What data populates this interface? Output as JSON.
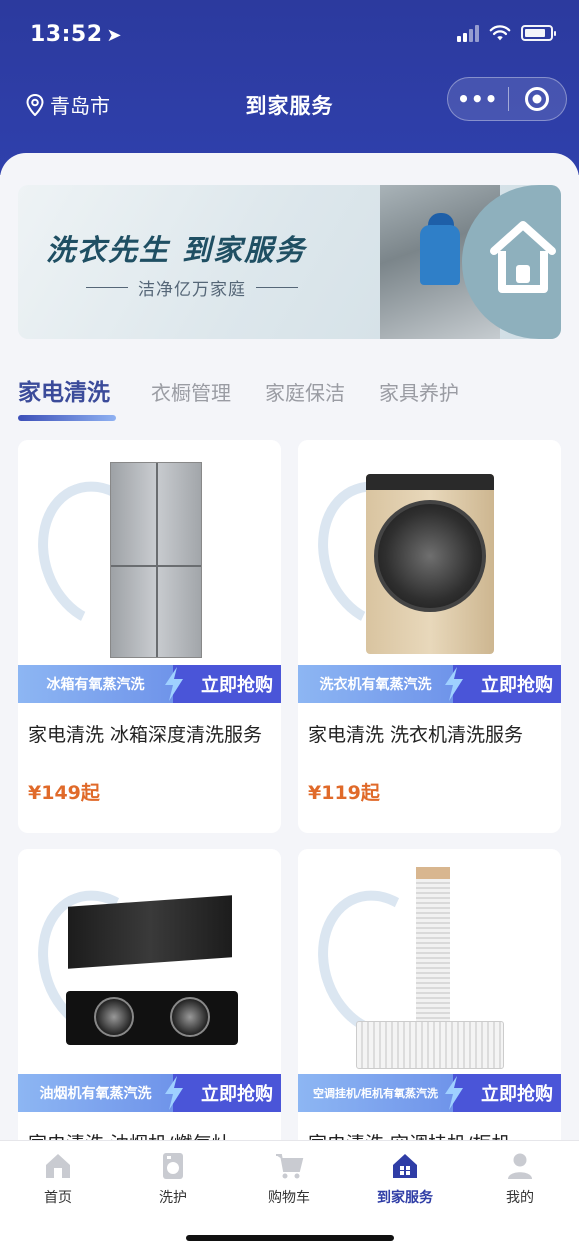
{
  "status_bar": {
    "time": "13:52"
  },
  "nav": {
    "location": "青岛市",
    "title": "到家服务",
    "more_icon": "more-dots-icon",
    "target_icon": "target-icon"
  },
  "banner": {
    "title": "洗衣先生 到家服务",
    "subtitle": "洁净亿万家庭"
  },
  "tabs": [
    {
      "label": "家电清洗",
      "active": true
    },
    {
      "label": "衣橱管理",
      "active": false
    },
    {
      "label": "家庭保洁",
      "active": false
    },
    {
      "label": "家具养护",
      "active": false
    }
  ],
  "products": [
    {
      "tag": "冰箱有氧蒸汽洗",
      "cta": "立即抢购",
      "title": "家电清洗 冰箱深度清洗服务",
      "price": "¥149起"
    },
    {
      "tag": "洗衣机有氧蒸汽洗",
      "cta": "立即抢购",
      "title": "家电清洗 洗衣机清洗服务",
      "price": "¥119起"
    },
    {
      "tag": "油烟机有氧蒸汽洗",
      "cta": "立即抢购",
      "title": "家电清洗 油烟机/燃气灶",
      "price": ""
    },
    {
      "tag": "空调挂机/柜机有氧蒸汽洗",
      "cta": "立即抢购",
      "title": "家电清洗 空调挂机/柜机",
      "price": ""
    }
  ],
  "tabbar": [
    {
      "label": "首页",
      "icon": "home-icon"
    },
    {
      "label": "洗护",
      "icon": "laundry-icon"
    },
    {
      "label": "购物车",
      "icon": "cart-icon"
    },
    {
      "label": "到家服务",
      "icon": "house-service-icon",
      "active": true
    },
    {
      "label": "我的",
      "icon": "user-icon"
    }
  ],
  "colors": {
    "header": "#2f3da6",
    "accent": "#4a55d8",
    "price": "#e06a2a"
  }
}
